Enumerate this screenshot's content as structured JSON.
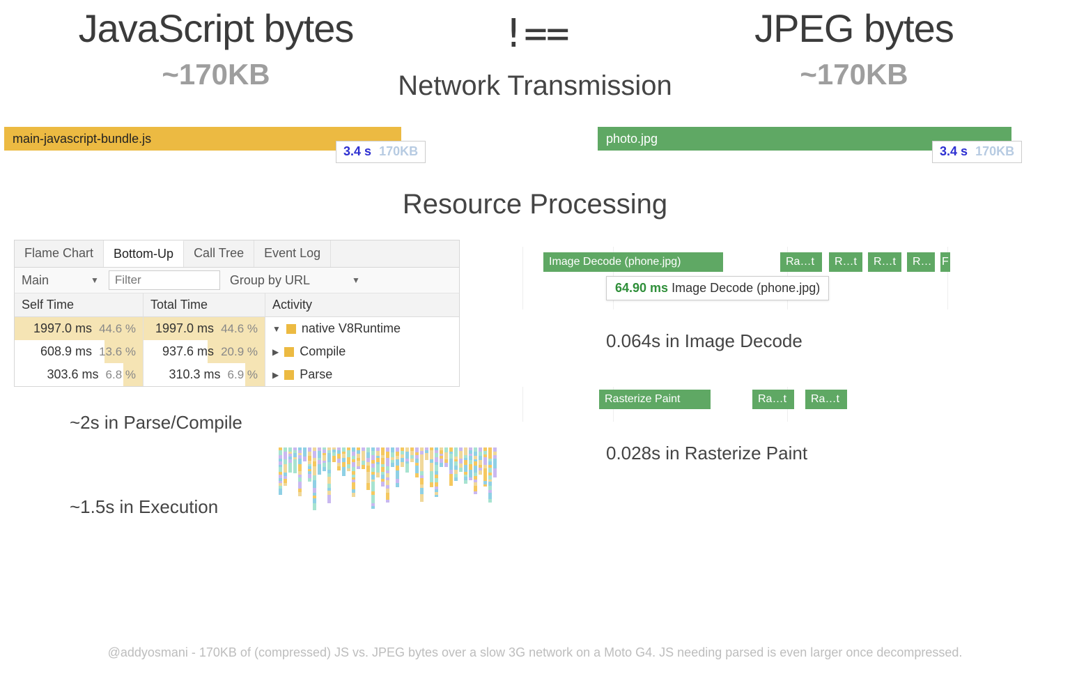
{
  "header": {
    "left_title": "JavaScript bytes",
    "mid": "!==",
    "right_title": "JPEG bytes",
    "left_size": "~170KB",
    "right_size": "~170KB"
  },
  "sections": {
    "network": "Network Transmission",
    "processing": "Resource Processing"
  },
  "bars": {
    "js_name": "main-javascript-bundle.js",
    "js_time": "3.4 s",
    "js_size": "170KB",
    "jpg_name": "photo.jpg",
    "jpg_time": "3.4 s",
    "jpg_size": "170KB"
  },
  "devtools": {
    "tabs": [
      "Flame Chart",
      "Bottom-Up",
      "Call Tree",
      "Event Log"
    ],
    "active_tab": "Bottom-Up",
    "thread": "Main",
    "filter_placeholder": "Filter",
    "group_by": "Group by URL",
    "columns": [
      "Self Time",
      "Total Time",
      "Activity"
    ],
    "rows": [
      {
        "self_ms": "1997.0 ms",
        "self_pct": "44.6 %",
        "self_bar_pct": 100,
        "total_ms": "1997.0 ms",
        "total_pct": "44.6 %",
        "total_bar_pct": 100,
        "activity": "native V8Runtime",
        "tri": "▼"
      },
      {
        "self_ms": "608.9 ms",
        "self_pct": "13.6 %",
        "self_bar_pct": 30,
        "total_ms": "937.6 ms",
        "total_pct": "20.9 %",
        "total_bar_pct": 47,
        "activity": "Compile",
        "tri": "▶"
      },
      {
        "self_ms": "303.6 ms",
        "self_pct": "6.8 %",
        "self_bar_pct": 15,
        "total_ms": "310.3 ms",
        "total_pct": "6.9 %",
        "total_bar_pct": 16,
        "activity": "Parse",
        "tri": "▶"
      }
    ]
  },
  "left_captions": {
    "parse": "~2s in Parse/Compile",
    "exec": "~1.5s in Execution"
  },
  "right_timeline": {
    "decode_label": "Image Decode (phone.jpg)",
    "chips": [
      "Ra…t",
      "R…t",
      "R…t",
      "R…",
      "F"
    ],
    "tooltip_ms": "64.90 ms",
    "tooltip_label": "Image Decode (phone.jpg)",
    "caption": "0.064s in Image Decode",
    "raster_label": "Rasterize Paint",
    "raster_chips": [
      "Ra…t",
      "Ra…t"
    ],
    "caption2": "0.028s in Rasterize Paint"
  },
  "footer": "@addyosmani - 170KB of (compressed) JS vs. JPEG bytes over a slow 3G network on a Moto G4. JS needing parsed is even larger once decompressed."
}
